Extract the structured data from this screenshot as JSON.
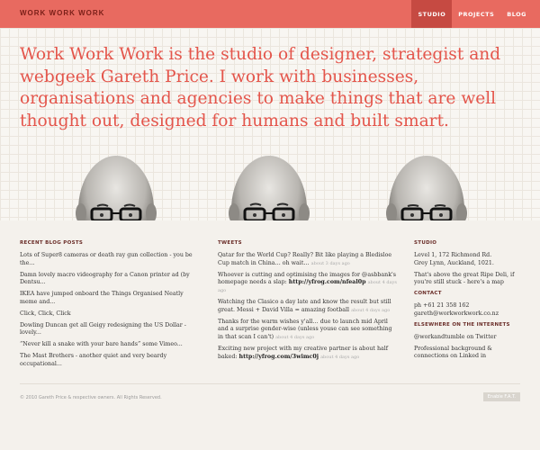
{
  "header": {
    "logo": "WORK WORK WORK",
    "nav": [
      {
        "label": "STUDIO"
      },
      {
        "label": "PROJECTS"
      },
      {
        "label": "BLOG"
      }
    ]
  },
  "hero": {
    "intro": "Work Work Work is the studio of designer, strategist and webgeek Gareth Price. I work with businesses, organisations and agencies to make things that are well thought out, designed for humans and built smart."
  },
  "blog": {
    "heading": "RECENT BLOG POSTS",
    "posts": [
      "Lots of Super8 cameras or death ray gun collection - you be the...",
      "Damn lovely macro videography for a Canon printer ad (by Dentsu...",
      "IKEA have jumped onboard the Things Organised Neatly meme and...",
      "Click, Click, Click",
      "Dowling Duncan get all Geigy redesigning the US Dollar - lovely...",
      "“Never kill a snake with your bare hands” some Vimeo...",
      "The Mast Brothers - another quiet and very beardy occupational..."
    ]
  },
  "tweets": {
    "heading": "TWEETS",
    "items": [
      {
        "text": "Qatar for the World Cup? Really? Bit like playing a Bledisloe Cup match in China… oh wait…",
        "link": "",
        "time": "about 3 days ago"
      },
      {
        "text": "Whoever is cutting and optimising the images for @asbbank's homepage needs a slap:",
        "link": "http://yfrog.com/nfeal0p",
        "time": "about 4 days ago"
      },
      {
        "text": "Watching the Clasico a day late and know the result but still great. Messi + David Villa = amazing football",
        "link": "",
        "time": "about 4 days ago"
      },
      {
        "text": "Thanks for the warm wishes y'all… due to launch mid April and a surprise gender-wise (unless youse can see something in that scan I can't)",
        "link": "",
        "time": "about 4 days ago"
      },
      {
        "text": "Exciting new project with my creative partner is about half baked:",
        "link": "http://yfrog.com/3wimc0j",
        "time": "about 4 days ago"
      }
    ]
  },
  "studio": {
    "heading": "STUDIO",
    "address": [
      "Level 1, 172 Richmond Rd.",
      "Grey Lynn, Auckland, 1021."
    ],
    "note": "That's above the great Ripe Deli, if you're still stuck - here's a map",
    "contact_heading": "CONTACT",
    "phone": "ph +61 21 358 162",
    "email": "gareth@workworkwork.co.nz",
    "elsewhere_heading": "ELSEWHERE ON THE INTERNETS",
    "links": [
      "@workandtumble on Twitter",
      "Professional background & connections on Linked in"
    ]
  },
  "footer": {
    "copyright": "© 2010 Gareth Price & respective owners. All Rights Reserved.",
    "button": "Enable F.A.T."
  }
}
